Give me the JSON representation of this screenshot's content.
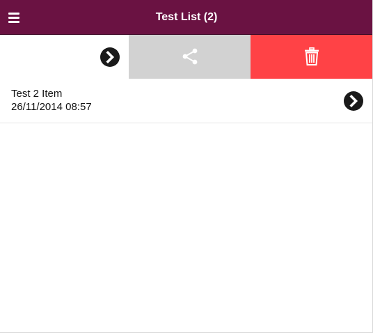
{
  "header": {
    "title": "Test List (2)",
    "menu_icon": "hamburger-menu-icon",
    "background_color": "#6a1242"
  },
  "swipe_actions": {
    "open_icon": "chevron-right-circle-icon",
    "share_icon": "share-icon",
    "share_color": "#d2d2d2",
    "delete_icon": "trash-icon",
    "delete_color": "#ff4246"
  },
  "list": {
    "items": [
      {
        "title": "Test 2 Item",
        "date": "26/11/2014 08:57",
        "open_icon": "chevron-right-circle-icon"
      }
    ]
  }
}
